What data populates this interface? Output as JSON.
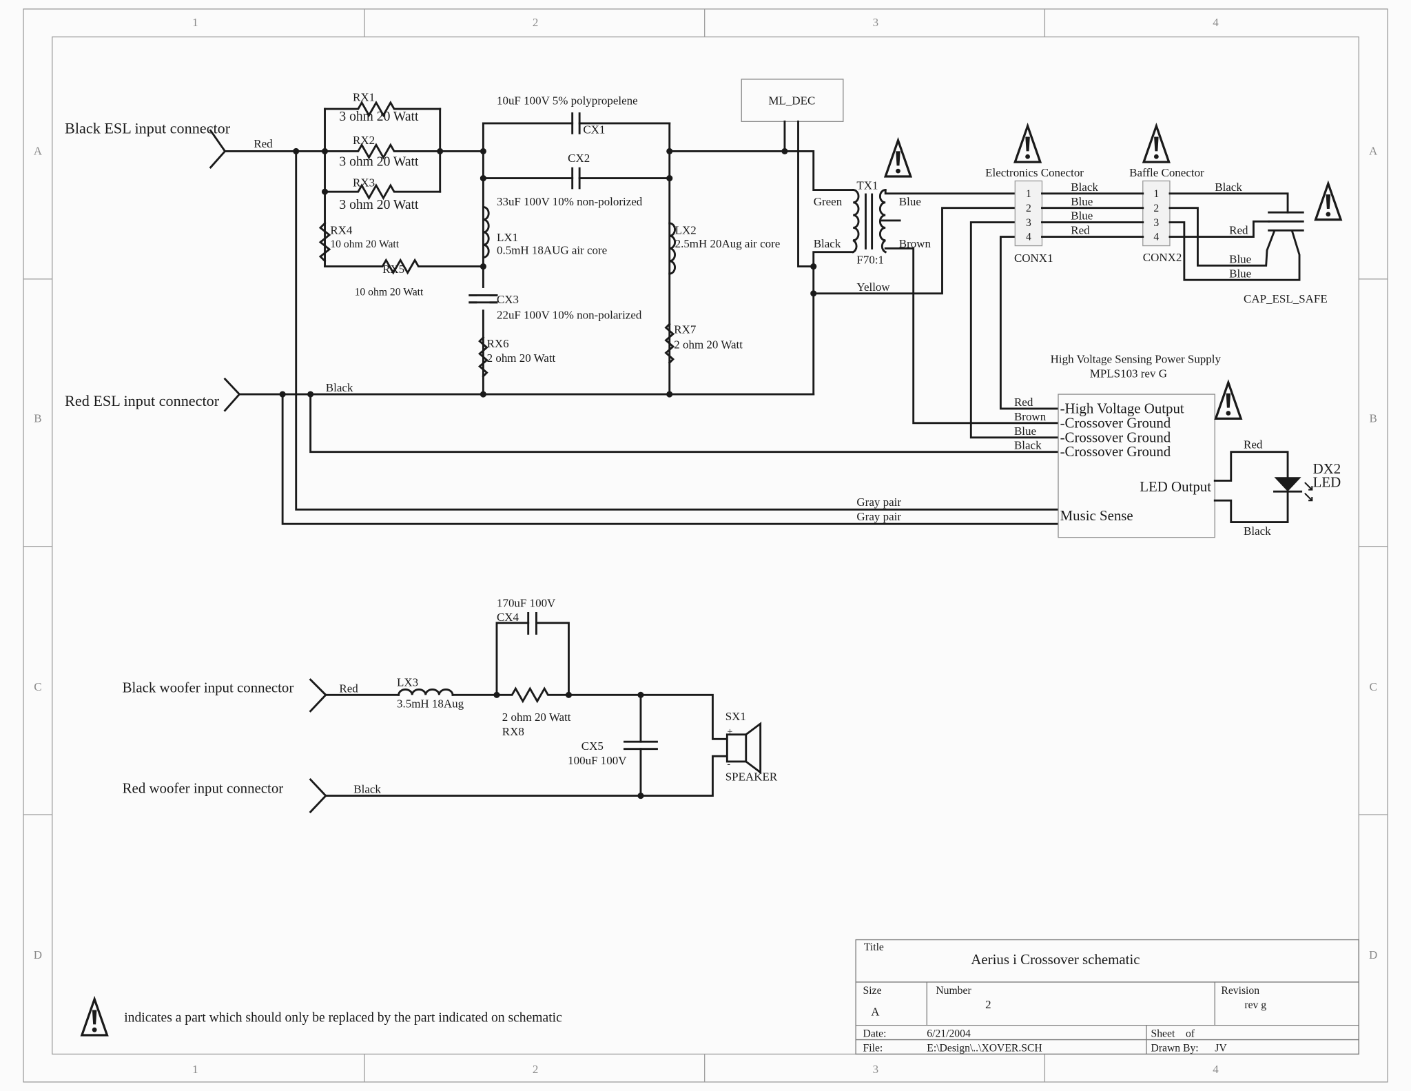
{
  "sheet": {
    "column_labels": [
      "1",
      "2",
      "3",
      "4"
    ],
    "row_labels": [
      "A",
      "B",
      "C",
      "D"
    ]
  },
  "esl_section": {
    "black_input_label": "Black ESL input connector",
    "red_input_label": "Red ESL input connector",
    "wire_red": "Red",
    "wire_black": "Black",
    "rx1": {
      "ref": "RX1",
      "value": "3 ohm 20 Watt"
    },
    "rx2": {
      "ref": "RX2",
      "value": "3 ohm 20 Watt"
    },
    "rx3": {
      "ref": "RX3",
      "value": "3 ohm 20 Watt"
    },
    "rx4": {
      "ref": "RX4",
      "value": "10 ohm 20 Watt"
    },
    "rx5": {
      "ref": "RX5",
      "value": "10 ohm 20 Watt"
    },
    "cx1": {
      "ref": "CX1",
      "value": "10uF 100V 5% polypropelene"
    },
    "cx2": {
      "ref": "CX2",
      "value": "33uF 100V 10% non-polorized"
    },
    "lx1": {
      "ref": "LX1",
      "value": "0.5mH 18AUG air core"
    },
    "lx2": {
      "ref": "LX2",
      "value": "2.5mH 20Aug air core"
    },
    "cx3": {
      "ref": "CX3",
      "value": "22uF 100V 10% non-polarized"
    },
    "rx6": {
      "ref": "RX6",
      "value": "2 ohm 20 Watt"
    },
    "rx7": {
      "ref": "RX7",
      "value": "2 ohm 20 Watt"
    },
    "ml_dec": "ML_DEC",
    "tx1": {
      "ref": "TX1",
      "value": "F70:1",
      "primary_top": "Green",
      "primary_bottom": "Black",
      "secondary_top": "Blue",
      "secondary_bottom": "Brown",
      "tap": "Yellow"
    }
  },
  "connectors": {
    "conx1": {
      "title": "Electronics Conector",
      "ref": "CONX1",
      "pins": [
        "1",
        "2",
        "3",
        "4"
      ]
    },
    "conx2": {
      "title": "Baffle Conector",
      "ref": "CONX2",
      "pins": [
        "1",
        "2",
        "3",
        "4"
      ]
    },
    "between_wires": [
      "Black",
      "Blue",
      "Blue",
      "Red"
    ],
    "right_wires": {
      "black": "Black",
      "red": "Red",
      "blue1": "Blue",
      "blue2": "Blue"
    },
    "cap_safe": "CAP_ESL_SAFE"
  },
  "power_supply": {
    "title": "High Voltage Sensing Power Supply",
    "model": "MPLS103 rev G",
    "pins": [
      "-High Voltage Output",
      "-Crossover Ground",
      "-Crossover Ground",
      "-Crossover Ground"
    ],
    "pin_wires": [
      "Red",
      "Brown",
      "Blue",
      "Black"
    ],
    "led_output": "LED Output",
    "music_sense": "Music Sense",
    "gray_pair_1": "Gray pair",
    "gray_pair_2": "Gray pair",
    "led": {
      "ref": "DX2",
      "value": "LED",
      "wire_top": "Red",
      "wire_bottom": "Black"
    }
  },
  "woofer_section": {
    "black_input_label": "Black woofer input connector",
    "red_input_label": "Red woofer input connector",
    "wire_red": "Red",
    "wire_black": "Black",
    "lx3": {
      "ref": "LX3",
      "value": "3.5mH 18Aug"
    },
    "cx4": {
      "ref": "CX4",
      "value": "170uF 100V"
    },
    "rx8": {
      "ref": "RX8",
      "value": "2 ohm 20 Watt"
    },
    "cx5": {
      "ref": "CX5",
      "value": "100uF 100V"
    },
    "sx1": {
      "ref": "SX1",
      "value": "SPEAKER",
      "plus": "+",
      "minus": "-"
    }
  },
  "legend": {
    "warning_note": "indicates a part which should only be replaced by the part indicated on schematic"
  },
  "title_block": {
    "title_label": "Title",
    "title": "Aerius i Crossover schematic",
    "size_label": "Size",
    "size": "A",
    "number_label": "Number",
    "number": "2",
    "revision_label": "Revision",
    "revision": "rev g",
    "date_label": "Date:",
    "date": "6/21/2004",
    "sheet_label": "Sheet    of",
    "file_label": "File:",
    "file": "E:\\Design\\..\\XOVER.SCH",
    "drawn_by_label": "Drawn By:",
    "drawn_by": "JV"
  }
}
